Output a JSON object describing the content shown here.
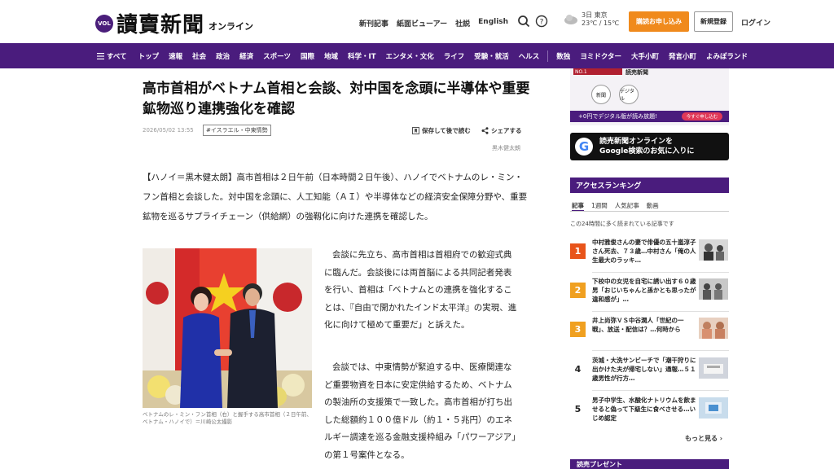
{
  "header": {
    "logo_badge": "VOL",
    "logo_text": "讀賣新聞",
    "logo_sub": "オンライン",
    "top_links": [
      "新刊記事",
      "紙面ビューアー",
      "社説",
      "English"
    ],
    "weather": {
      "day": "3日",
      "city": "東京",
      "temps": "23℃ / 15℃"
    },
    "subscribe_label": "購読お申し込み",
    "register_label": "新規登録",
    "login_label": "ログイン"
  },
  "nav": {
    "menu_label": "すべて",
    "items": [
      "トップ",
      "速報",
      "社会",
      "政治",
      "経済",
      "スポーツ",
      "国際",
      "地域",
      "科学・IT",
      "エンタメ・文化",
      "ライフ",
      "受験・就活",
      "ヘルス"
    ],
    "items2": [
      "数独",
      "ヨミドクター",
      "大手小町",
      "発言小町",
      "よみぽランド"
    ]
  },
  "article": {
    "headline": "高市首相がベトナム首相と会談、対中国を念頭に半導体や重要鉱物巡り連携強化を確認",
    "date": "2026/05/02 13:55",
    "tag": "#イスラエル・中東情勢",
    "save_label": "保存して後で読む",
    "share_label": "シェアする",
    "byline": "黒木健太朗",
    "lede": "【ハノイ＝黒木健太朗】高市首相は２日午前（日本時間２日午後）、ハノイでベトナムのレ・ミン・フン首相と会談した。対中国を念頭に、人工知能（ＡＩ）や半導体などの経済安全保障分野や、重要鉱物を巡るサプライチェーン（供給網）の強靱化に向けた連携を確認した。",
    "body1": "会談に先立ち、高市首相は首相府での歓迎式典に臨んだ。会談後には両首脳による共同記者発表を行い、首相は「ベトナムとの連携を強化することは、『自由で開かれたインド太平洋』の実現、進化に向けて極めて重要だ」と訴えた。",
    "body2": "会談では、中東情勢が緊迫する中、医療関連など重要物資を日本に安定供給するため、ベトナムの製油所の支援策で一致した。高市首相が打ち出した総額約１００億ドル（約１・５兆円）のエネルギー調達を巡る金融支援枠組み「パワーアジア」の第１号案件となる。",
    "caption": "ベトナムのレ・ミン・フン首相（右）と握手する高市首相（２日午前、ベトナム・ハノイで）＝川崎公太撮影"
  },
  "sidebar": {
    "ad_banner": "NO.1",
    "ad_title": "読売新聞",
    "ad_circles": [
      "新聞",
      "デジタル"
    ],
    "ad_strip": "+0円でデジタル版が読み放題!",
    "ad_strip_btn": "今すぐ申し込む",
    "google_line1": "読売新聞オンラインを",
    "google_line2": "Google検索のお気に入りに",
    "ranking_title": "アクセスランキング",
    "ranking_tabs": [
      "記事",
      "1週間",
      "人気記事",
      "動画"
    ],
    "ranking_note": "この24時間に多く読まれている記事です",
    "ranking": [
      {
        "num": "1",
        "text": "中村雅俊さんの妻で俳優の五十嵐淳子さん死去、７３歳…中村さん「俺の人生最大のラッキ…"
      },
      {
        "num": "2",
        "text": "下校中の女児を自宅に誘い出す６０歳男「おじいちゃんと孫かとも思ったが違和感が」…"
      },
      {
        "num": "3",
        "text": "井上尚弥ＶＳ中谷潤人「世紀の一戦」、放送・配信は？…何時から"
      },
      {
        "num": "4",
        "text": "茨城・大洗サンビーチで「潮干狩りに出かけた夫が帰宅しない」通報…５１歳男性が行方…"
      },
      {
        "num": "5",
        "text": "男子中学生、水酸化ナトリウムを飲ませると偽って下級生に食べさせる…いじめ認定"
      }
    ],
    "more_label": "もっと見る",
    "bottom_label": "読売プレゼント"
  },
  "colors": {
    "brand": "#4a1c7d",
    "accent": "#f08a1c",
    "rank_hot": "#e8541a",
    "rank_mid": "#f0a020"
  }
}
